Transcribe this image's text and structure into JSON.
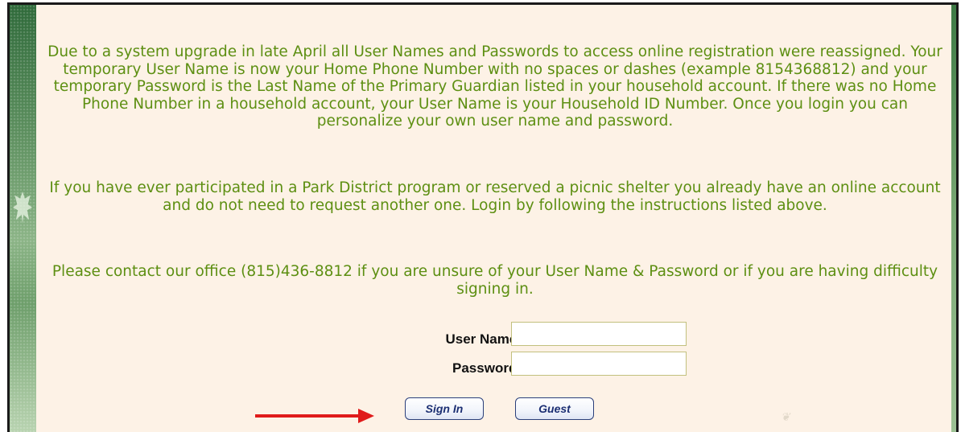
{
  "notice": {
    "paragraph1": "Due to a system upgrade in late April all User Names and Passwords to access online registration were reassigned. Your temporary User Name is now your Home Phone Number with no spaces or dashes (example 8154368812) and your temporary Password is the Last Name of the Primary Guardian listed in your household account. If there was no Home Phone Number in a household account, your User Name is your Household ID Number. Once you login you can personalize your own user name and password.",
    "paragraph2": "If you have ever participated in a Park District program or reserved a picnic shelter you already have an online account and do not need to request another one. Login by following the instructions listed above.",
    "paragraph3": "Please contact our office (815)436-8812 if you are unsure of your User Name & Password or if you are having difficulty signing in."
  },
  "login": {
    "username_label": "User Name:",
    "username_value": "",
    "password_label": "Password:",
    "password_value": "",
    "signin_label": "Sign In",
    "guest_label": "Guest"
  },
  "colors": {
    "text": "#5d8f12",
    "panel": "#fdf2e6",
    "button_text": "#1c2f73",
    "arrow": "#e01b1b"
  }
}
